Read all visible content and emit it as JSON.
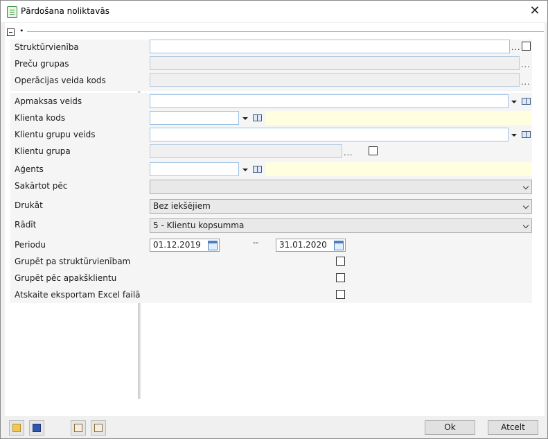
{
  "window": {
    "title": "Pārdošana noliktavās",
    "app_icon": "document-icon",
    "close_glyph": "✕"
  },
  "group": {
    "toggle": "collapse-icon",
    "dot": "•"
  },
  "fields": {
    "strukturvieniba": {
      "label": "Struktūrvienība",
      "value": "",
      "ellipsis": "..."
    },
    "precu_grupas": {
      "label": "Preču grupas",
      "value": "",
      "ellipsis": "..."
    },
    "operacijas_veida_kods": {
      "label": "Operācijas veida kods",
      "value": "",
      "ellipsis": "..."
    },
    "apmaksas_veids": {
      "label": "Apmaksas veids",
      "value": ""
    },
    "klienta_kods": {
      "label": "Klienta kods",
      "value": ""
    },
    "klientu_grupu_veids": {
      "label": "Klientu grupu veids",
      "value": ""
    },
    "klientu_grupa": {
      "label": "Klientu grupa",
      "value": "",
      "ellipsis": "..."
    },
    "agents": {
      "label": "Aģents",
      "value": ""
    },
    "sakartot_pec": {
      "label": "Sakārtot pēc",
      "value": ""
    },
    "drukat": {
      "label": "Drukāt",
      "value": "Bez iekšējiem"
    },
    "radit": {
      "label": "Rādīt",
      "value": "5 - Klientu kopsumma"
    },
    "periodu": {
      "label": "Periodu",
      "from": "01.12.2019",
      "separator": "--",
      "to": "31.01.2020"
    },
    "grupet_struktur": {
      "label": "Grupēt pa struktūrvienībam",
      "checked": false
    },
    "grupet_apakskl": {
      "label": "Grupēt pēc apakšklientu",
      "checked": false
    },
    "excel": {
      "label": "Atskaite eksportam Excel failā",
      "checked": false
    }
  },
  "footer": {
    "tools": [
      "open-folder-icon",
      "save-icon",
      "clipboard-icon",
      "paste-icon"
    ],
    "ok_label": "Ok",
    "cancel_label": "Atcelt"
  }
}
